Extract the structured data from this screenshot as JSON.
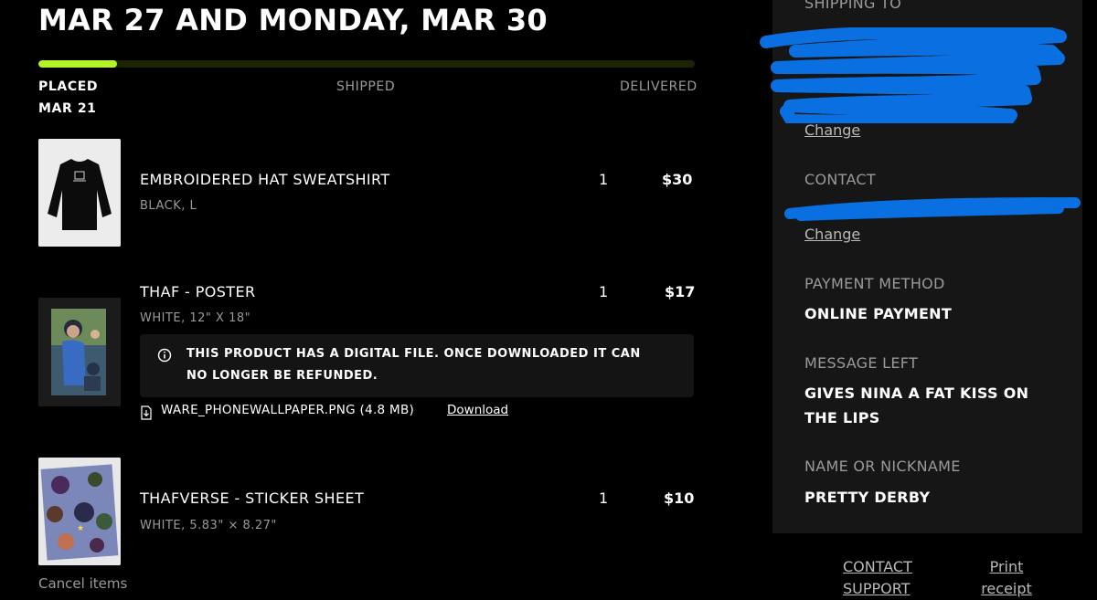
{
  "header": {
    "headline": "MAR 27 AND MONDAY, MAR 30"
  },
  "progress": {
    "fraction": 0.12,
    "steps": [
      "PLACED",
      "SHIPPED",
      "DELIVERED"
    ],
    "placed_date": "MAR 21",
    "accent_color": "#b6f22a"
  },
  "items": [
    {
      "name": "EMBROIDERED HAT SWEATSHIRT",
      "variant": "BLACK, L",
      "qty": "1",
      "price": "$30"
    },
    {
      "name": "THAF - POSTER",
      "variant": "WHITE, 12\" X 18\"",
      "qty": "1",
      "price": "$17",
      "notice": "THIS PRODUCT HAS A DIGITAL FILE. ONCE DOWNLOADED IT CAN NO LONGER BE REFUNDED.",
      "file_name": "WARE_PHONEWALLPAPER.PNG (4.8 MB)",
      "download_label": "Download"
    },
    {
      "name": "THAFVERSE - STICKER SHEET",
      "variant": "WHITE, 5.83\" × 8.27\"",
      "qty": "1",
      "price": "$10"
    }
  ],
  "cancel_label": "Cancel items",
  "panel": {
    "shipping_label": "SHIPPING TO",
    "shipping_change": "Change",
    "contact_label": "CONTACT",
    "contact_change": "Change",
    "payment_label": "PAYMENT METHOD",
    "payment_value": "ONLINE PAYMENT",
    "message_label": "MESSAGE LEFT",
    "message_value": "GIVES NINA A FAT KISS ON THE LIPS",
    "name_label": "NAME OR NICKNAME",
    "name_value": "PRETTY DERBY",
    "redaction_color": "#0a6fe0"
  },
  "footer": {
    "contact_support": "CONTACT SUPPORT",
    "print_receipt": "Print receipt"
  }
}
